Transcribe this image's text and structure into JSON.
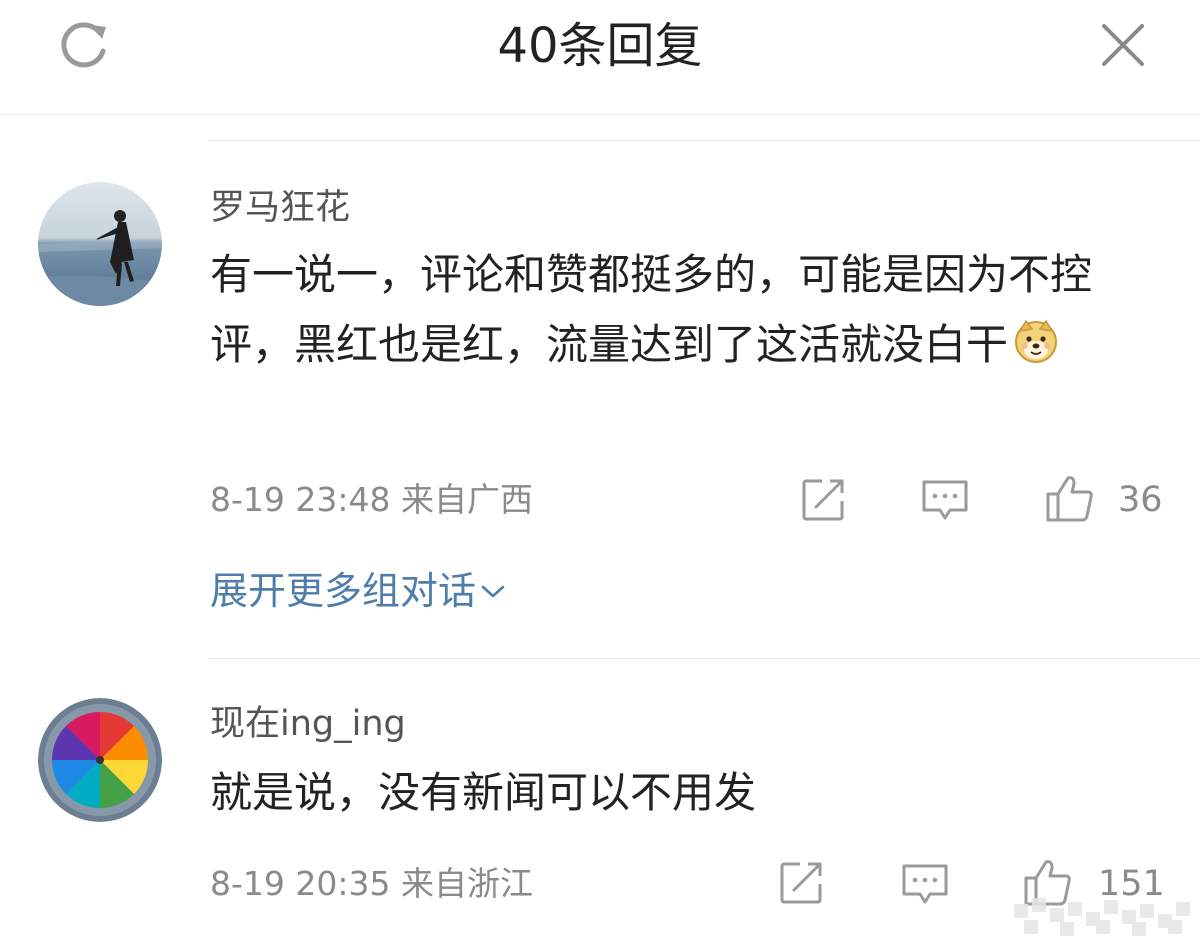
{
  "header": {
    "title": "40条回复",
    "refresh_icon": "refresh-icon",
    "close_icon": "close-icon"
  },
  "comments": [
    {
      "username": "罗马狂花",
      "text": "有一说一，评论和赞都挺多的，可能是因为不控评，黑红也是红，流量达到了这活就没白干",
      "emoji": "doge-emoji",
      "time": "8-19 23:48",
      "location": "来自广西",
      "likes": "36",
      "expand_label": "展开更多组对话"
    },
    {
      "username": "现在ing_ing",
      "text": "就是说，没有新闻可以不用发",
      "time": "8-19 20:35",
      "location": "来自浙江",
      "likes": "151"
    }
  ],
  "colors": {
    "link": "#4f7dab",
    "text": "#222222",
    "meta": "#8a8a8a",
    "icon": "#9a9a9a"
  }
}
